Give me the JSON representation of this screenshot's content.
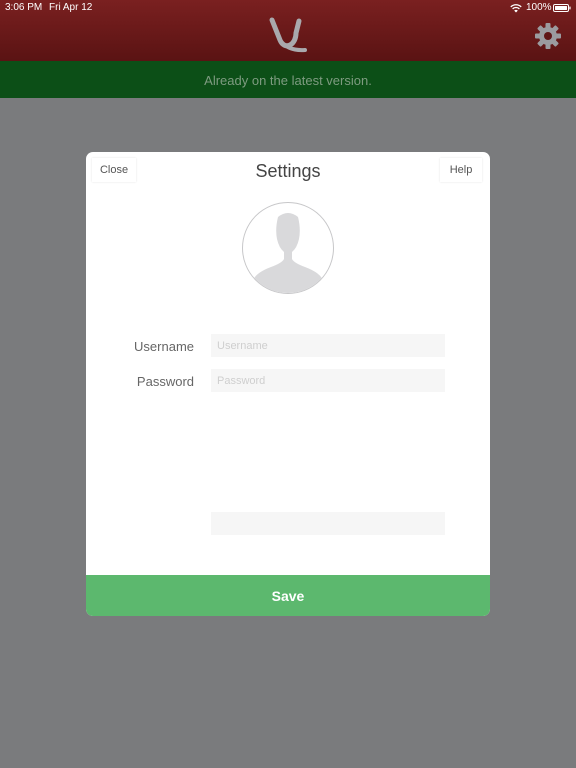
{
  "status_bar": {
    "time": "3:06 PM",
    "date": "Fri Apr 12",
    "battery": "100%",
    "icons": [
      "wifi-icon",
      "battery-icon"
    ]
  },
  "header": {
    "logo": "logo-icon",
    "settings_icon": "gear-icon",
    "bar_color": "#6b1a1a"
  },
  "notice": {
    "text": "Already on the latest version.",
    "bar_color": "#0c4f17"
  },
  "modal": {
    "title": "Settings",
    "close_label": "Close",
    "help_label": "Help",
    "avatar_icon": "user-silhouette-icon",
    "fields": [
      {
        "label": "Username",
        "placeholder": "Username",
        "value": ""
      },
      {
        "label": "Password",
        "placeholder": "Password",
        "value": ""
      }
    ],
    "extra_field": {
      "value": ""
    },
    "save_label": "Save",
    "save_color": "#5cb86e"
  }
}
